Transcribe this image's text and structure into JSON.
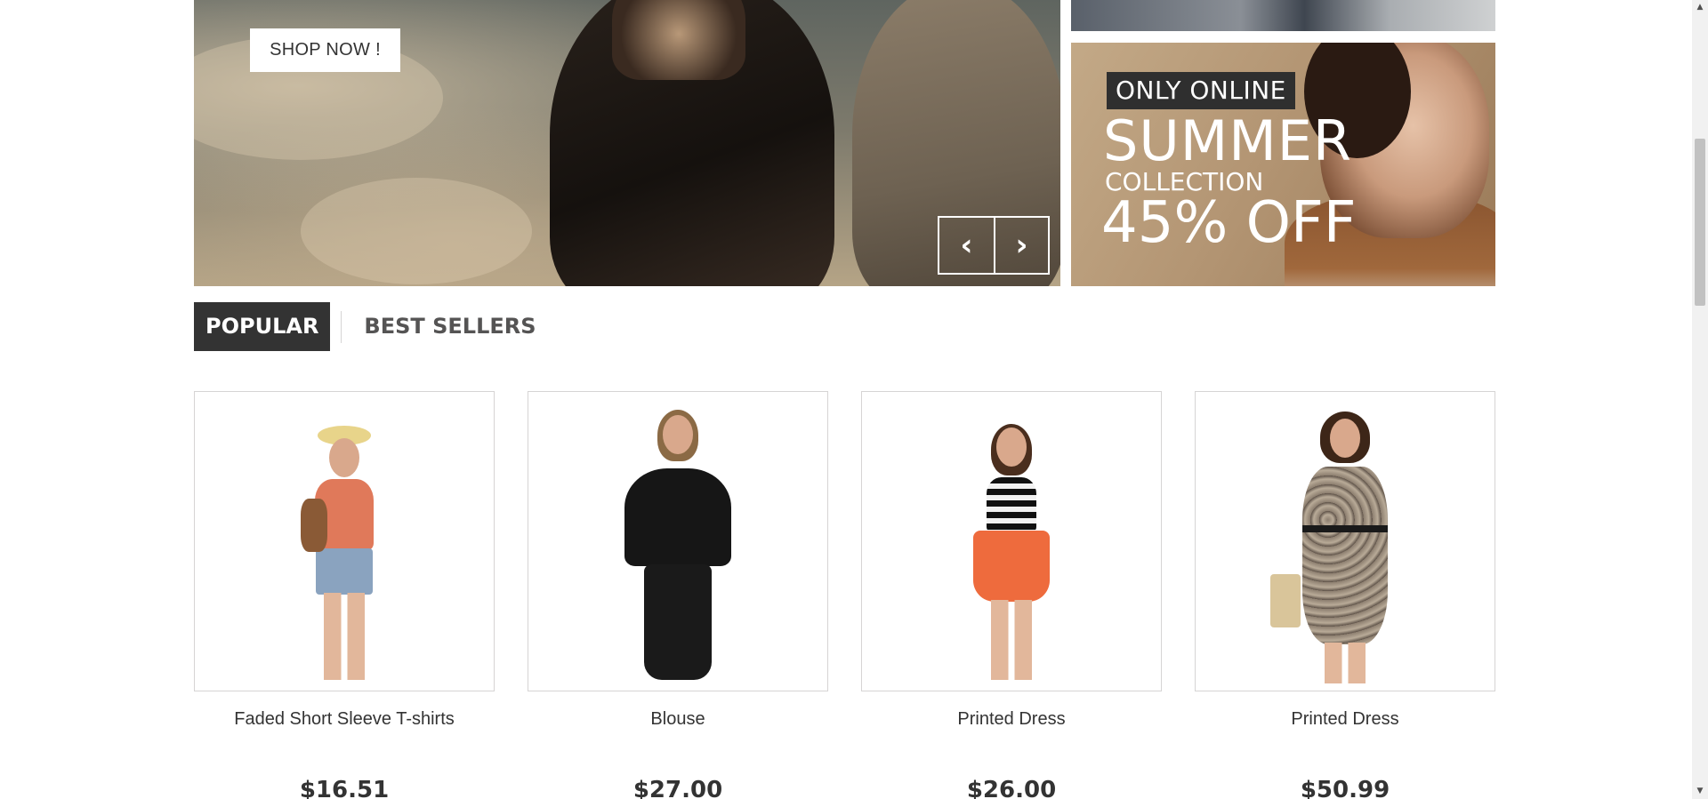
{
  "hero": {
    "cta_label": "SHOP NOW !",
    "prev_icon": "‹",
    "next_icon": "›"
  },
  "promo_banner": {
    "badge": "ONLY ONLINE",
    "headline": "SUMMER",
    "subline": "COLLECTION",
    "discount": "45% OFF"
  },
  "tabs": [
    {
      "label": "POPULAR",
      "active": true
    },
    {
      "label": "BEST SELLERS",
      "active": false
    }
  ],
  "products": [
    {
      "name": "Faded Short Sleeve T-shirts",
      "price": "$16.51"
    },
    {
      "name": "Blouse",
      "price": "$27.00"
    },
    {
      "name": "Printed Dress",
      "price": "$26.00"
    },
    {
      "name": "Printed Dress",
      "price": "$50.99"
    }
  ],
  "scrollbar": {
    "up_icon": "▲",
    "down_icon": "▼"
  },
  "colors": {
    "dark": "#333333",
    "border": "#d6d4d4",
    "tab_inactive": "#555454"
  }
}
